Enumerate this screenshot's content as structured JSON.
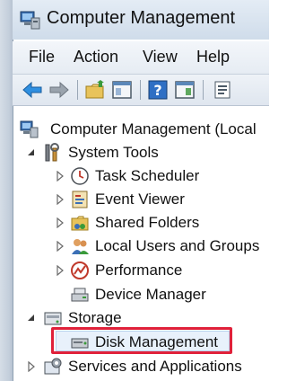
{
  "window": {
    "title": "Computer Management"
  },
  "menu": [
    {
      "label": "File"
    },
    {
      "label": "Action"
    },
    {
      "label": "View"
    },
    {
      "label": "Help"
    }
  ],
  "toolbar": {
    "icons": [
      "back-arrow-icon",
      "forward-arrow-icon",
      "up-folder-icon",
      "show-hide-console-tree-icon",
      "help-icon",
      "show-action-pane-icon",
      "properties-icon"
    ]
  },
  "tree": {
    "root": "Computer Management (Local",
    "system_tools": "System Tools",
    "task_scheduler": "Task Scheduler",
    "event_viewer": "Event Viewer",
    "shared_folders": "Shared Folders",
    "local_users": "Local Users and Groups",
    "performance": "Performance",
    "device_manager": "Device Manager",
    "storage": "Storage",
    "disk_management": "Disk Management",
    "services": "Services and Applications"
  },
  "colors": {
    "highlight": "#e0213a",
    "titlebar": "#cfdcea"
  }
}
